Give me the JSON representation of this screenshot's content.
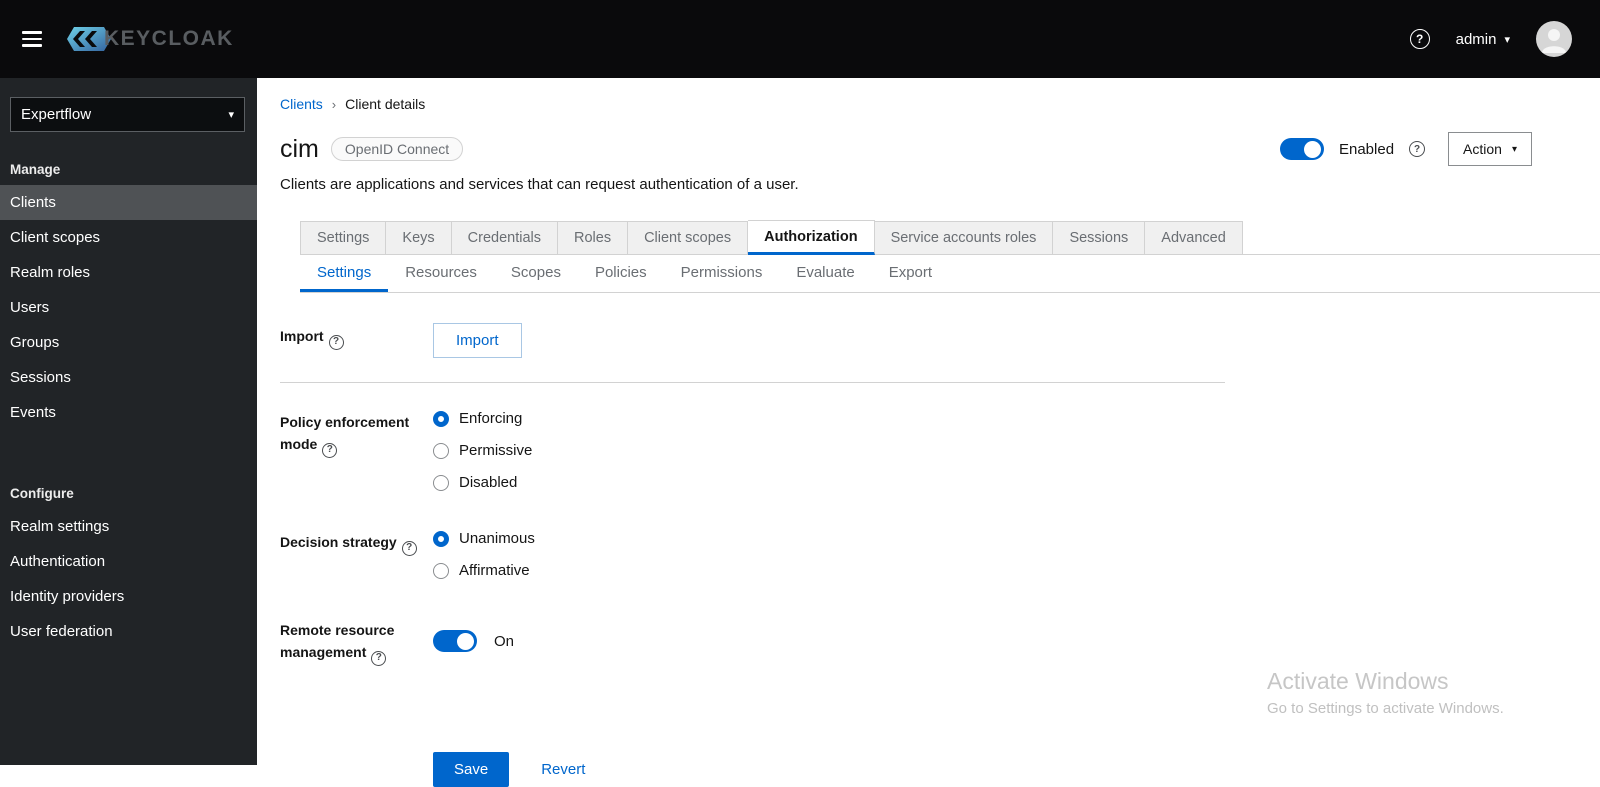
{
  "icons": {
    "help": "?",
    "caret": "▾",
    "breadcrumb_sep": "›"
  },
  "header": {
    "logo_text": "KEYCLOAK",
    "username": "admin"
  },
  "sidebar": {
    "realm": "Expertflow",
    "sections": [
      {
        "label": "Manage",
        "items": [
          {
            "label": "Clients",
            "active": true
          },
          {
            "label": "Client scopes",
            "active": false
          },
          {
            "label": "Realm roles",
            "active": false
          },
          {
            "label": "Users",
            "active": false
          },
          {
            "label": "Groups",
            "active": false
          },
          {
            "label": "Sessions",
            "active": false
          },
          {
            "label": "Events",
            "active": false
          }
        ]
      },
      {
        "label": "Configure",
        "items": [
          {
            "label": "Realm settings",
            "active": false
          },
          {
            "label": "Authentication",
            "active": false
          },
          {
            "label": "Identity providers",
            "active": false
          },
          {
            "label": "User federation",
            "active": false
          }
        ]
      }
    ]
  },
  "main": {
    "breadcrumb": {
      "parent": "Clients",
      "current": "Client details"
    },
    "title": "cim",
    "protocol_badge": "OpenID Connect",
    "description": "Clients are applications and services that can request authentication of a user.",
    "enabled_label": "Enabled",
    "enabled_state": "on",
    "action_label": "Action",
    "tabs": [
      "Settings",
      "Keys",
      "Credentials",
      "Roles",
      "Client scopes",
      "Authorization",
      "Service accounts roles",
      "Sessions",
      "Advanced"
    ],
    "active_tab": "Authorization",
    "subtabs": [
      "Settings",
      "Resources",
      "Scopes",
      "Policies",
      "Permissions",
      "Evaluate",
      "Export"
    ],
    "active_subtab": "Settings",
    "form": {
      "import_label": "Import",
      "import_button": "Import",
      "policy_label": "Policy enforcement mode",
      "policy_options": [
        "Enforcing",
        "Permissive",
        "Disabled"
      ],
      "policy_selected": "Enforcing",
      "decision_label": "Decision strategy",
      "decision_options": [
        "Unanimous",
        "Affirmative"
      ],
      "decision_selected": "Unanimous",
      "remote_label": "Remote resource management",
      "remote_state": "On",
      "save_label": "Save",
      "revert_label": "Revert"
    }
  },
  "watermark": {
    "line1": "Activate Windows",
    "line2": "Go to Settings to activate Windows."
  },
  "colors": {
    "accent": "#0066cc",
    "header_bg": "#0a0a0c",
    "sidebar_bg": "#212427",
    "sidebar_active": "#4f5255"
  }
}
